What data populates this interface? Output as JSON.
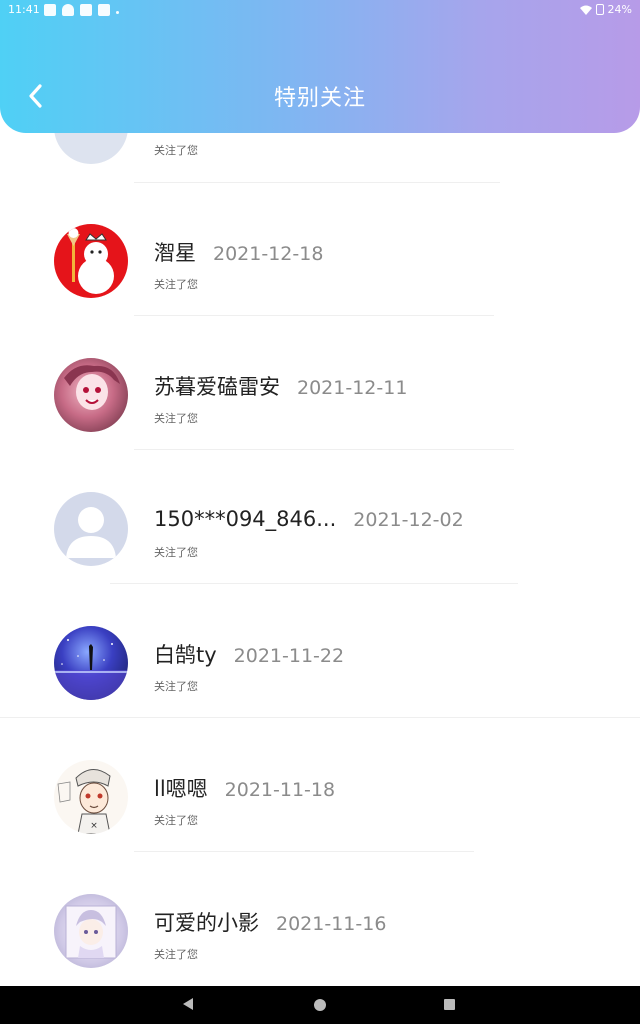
{
  "status_bar": {
    "time": "11:41",
    "battery": "24%"
  },
  "header": {
    "title": "特别关注",
    "back_icon": "chevron-left-icon"
  },
  "colors": {
    "header_start": "#4fd0f5",
    "header_end": "#b79be8"
  },
  "follows": [
    {
      "name": "",
      "date": "",
      "sub": "关注了您",
      "avatar": "default-avatar"
    },
    {
      "name": "潪星",
      "date": "2021-12-18",
      "sub": "关注了您",
      "avatar": "snowman-avatar"
    },
    {
      "name": "苏暮爱磕雷安",
      "date": "2021-12-11",
      "sub": "关注了您",
      "avatar": "anime-pink-avatar"
    },
    {
      "name": "150***094_846...",
      "date": "2021-12-02",
      "sub": "关注了您",
      "avatar": "default-avatar"
    },
    {
      "name": "白鹄ty",
      "date": "2021-11-22",
      "sub": "关注了您",
      "avatar": "night-sky-avatar"
    },
    {
      "name": "ll嗯嗯",
      "date": "2021-11-18",
      "sub": "关注了您",
      "avatar": "anime-sketch-avatar"
    },
    {
      "name": "可爱的小影",
      "date": "2021-11-16",
      "sub": "关注了您",
      "avatar": "anime-doll-avatar"
    }
  ]
}
